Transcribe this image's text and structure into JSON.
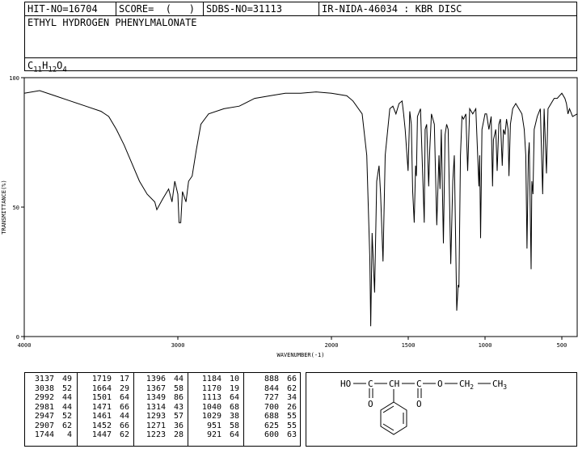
{
  "header": {
    "hit_no": "HIT-NO=16704",
    "score": "SCORE=  (   )",
    "sdbs_no": "SDBS-NO=31113",
    "ir_id": "IR-NIDA-46034 : KBR DISC",
    "compound_name": "ETHYL HYDROGEN PHENYLMALONATE",
    "formula": {
      "c": "C",
      "c_n": "11",
      "h": "H",
      "h_n": "12",
      "o": "O",
      "o_n": "4"
    }
  },
  "chart_data": {
    "type": "line",
    "xlabel": "WAVENUMBER(-1)",
    "ylabel": "TRANSMITTANCE(%)",
    "xlim": [
      4000,
      400
    ],
    "ylim": [
      0,
      100
    ],
    "x_ticks": [
      4000,
      3000,
      2000,
      1500,
      1000,
      500
    ],
    "y_ticks": [
      0,
      50,
      100
    ],
    "grid": false,
    "series": [
      {
        "points": [
          [
            4000,
            94
          ],
          [
            3900,
            95
          ],
          [
            3800,
            93
          ],
          [
            3700,
            91
          ],
          [
            3600,
            89
          ],
          [
            3500,
            87
          ],
          [
            3450,
            85
          ],
          [
            3400,
            80
          ],
          [
            3350,
            74
          ],
          [
            3300,
            67
          ],
          [
            3250,
            60
          ],
          [
            3200,
            55
          ],
          [
            3150,
            52
          ],
          [
            3137,
            49
          ],
          [
            3100,
            53
          ],
          [
            3060,
            57
          ],
          [
            3038,
            52
          ],
          [
            3020,
            60
          ],
          [
            3000,
            55
          ],
          [
            2992,
            44
          ],
          [
            2981,
            44
          ],
          [
            2970,
            56
          ],
          [
            2947,
            52
          ],
          [
            2930,
            60
          ],
          [
            2907,
            62
          ],
          [
            2880,
            72
          ],
          [
            2850,
            82
          ],
          [
            2800,
            86
          ],
          [
            2700,
            88
          ],
          [
            2600,
            89
          ],
          [
            2500,
            92
          ],
          [
            2400,
            93
          ],
          [
            2300,
            94
          ],
          [
            2200,
            94
          ],
          [
            2100,
            94.5
          ],
          [
            2000,
            94
          ],
          [
            1900,
            93
          ],
          [
            1860,
            91
          ],
          [
            1800,
            86
          ],
          [
            1770,
            70
          ],
          [
            1750,
            30
          ],
          [
            1744,
            4
          ],
          [
            1735,
            40
          ],
          [
            1719,
            17
          ],
          [
            1705,
            60
          ],
          [
            1690,
            66
          ],
          [
            1680,
            55
          ],
          [
            1664,
            29
          ],
          [
            1650,
            70
          ],
          [
            1620,
            88
          ],
          [
            1600,
            89
          ],
          [
            1580,
            86
          ],
          [
            1560,
            90
          ],
          [
            1540,
            91
          ],
          [
            1530,
            86
          ],
          [
            1520,
            80
          ],
          [
            1501,
            64
          ],
          [
            1490,
            87
          ],
          [
            1480,
            82
          ],
          [
            1471,
            56
          ],
          [
            1461,
            44
          ],
          [
            1452,
            66
          ],
          [
            1447,
            62
          ],
          [
            1440,
            85
          ],
          [
            1420,
            88
          ],
          [
            1396,
            44
          ],
          [
            1390,
            80
          ],
          [
            1380,
            82
          ],
          [
            1367,
            58
          ],
          [
            1360,
            72
          ],
          [
            1349,
            86
          ],
          [
            1330,
            82
          ],
          [
            1314,
            43
          ],
          [
            1300,
            70
          ],
          [
            1293,
            57
          ],
          [
            1285,
            80
          ],
          [
            1271,
            36
          ],
          [
            1260,
            78
          ],
          [
            1250,
            82
          ],
          [
            1240,
            80
          ],
          [
            1223,
            28
          ],
          [
            1210,
            60
          ],
          [
            1200,
            70
          ],
          [
            1184,
            10
          ],
          [
            1175,
            20
          ],
          [
            1170,
            19
          ],
          [
            1160,
            70
          ],
          [
            1150,
            85
          ],
          [
            1140,
            84
          ],
          [
            1125,
            86
          ],
          [
            1113,
            64
          ],
          [
            1100,
            88
          ],
          [
            1080,
            86
          ],
          [
            1060,
            88
          ],
          [
            1040,
            58
          ],
          [
            1035,
            70
          ],
          [
            1029,
            38
          ],
          [
            1020,
            80
          ],
          [
            1000,
            86
          ],
          [
            990,
            86
          ],
          [
            975,
            80
          ],
          [
            960,
            85
          ],
          [
            951,
            58
          ],
          [
            945,
            76
          ],
          [
            930,
            80
          ],
          [
            921,
            64
          ],
          [
            910,
            82
          ],
          [
            900,
            84
          ],
          [
            888,
            66
          ],
          [
            880,
            80
          ],
          [
            870,
            78
          ],
          [
            860,
            84
          ],
          [
            850,
            80
          ],
          [
            844,
            62
          ],
          [
            835,
            82
          ],
          [
            820,
            88
          ],
          [
            800,
            90
          ],
          [
            780,
            88
          ],
          [
            760,
            86
          ],
          [
            745,
            80
          ],
          [
            735,
            70
          ],
          [
            727,
            34
          ],
          [
            718,
            70
          ],
          [
            712,
            75
          ],
          [
            700,
            26
          ],
          [
            695,
            60
          ],
          [
            688,
            55
          ],
          [
            680,
            80
          ],
          [
            660,
            85
          ],
          [
            640,
            88
          ],
          [
            625,
            55
          ],
          [
            615,
            88
          ],
          [
            600,
            63
          ],
          [
            590,
            88
          ],
          [
            570,
            90
          ],
          [
            550,
            92
          ],
          [
            530,
            92
          ],
          [
            500,
            94
          ],
          [
            480,
            92
          ],
          [
            470,
            90
          ],
          [
            460,
            86
          ],
          [
            450,
            88
          ],
          [
            430,
            85
          ],
          [
            400,
            86
          ]
        ]
      }
    ]
  },
  "peak_table": {
    "columns": [
      [
        [
          "3137",
          "49"
        ],
        [
          "3038",
          "52"
        ],
        [
          "2992",
          "44"
        ],
        [
          "2981",
          "44"
        ],
        [
          "2947",
          "52"
        ],
        [
          "2907",
          "62"
        ],
        [
          "1744",
          "4"
        ]
      ],
      [
        [
          "1719",
          "17"
        ],
        [
          "1664",
          "29"
        ],
        [
          "1501",
          "64"
        ],
        [
          "1471",
          "66"
        ],
        [
          "1461",
          "44"
        ],
        [
          "1452",
          "66"
        ],
        [
          "1447",
          "62"
        ]
      ],
      [
        [
          "1396",
          "44"
        ],
        [
          "1367",
          "58"
        ],
        [
          "1349",
          "86"
        ],
        [
          "1314",
          "43"
        ],
        [
          "1293",
          "57"
        ],
        [
          "1271",
          "36"
        ],
        [
          "1223",
          "28"
        ]
      ],
      [
        [
          "1184",
          "10"
        ],
        [
          "1170",
          "19"
        ],
        [
          "1113",
          "64"
        ],
        [
          "1040",
          "68"
        ],
        [
          "1029",
          "38"
        ],
        [
          "951",
          "58"
        ],
        [
          "921",
          "64"
        ]
      ],
      [
        [
          "888",
          "66"
        ],
        [
          "844",
          "62"
        ],
        [
          "727",
          "34"
        ],
        [
          "700",
          "26"
        ],
        [
          "688",
          "55"
        ],
        [
          "625",
          "55"
        ],
        [
          "600",
          "63"
        ]
      ]
    ]
  },
  "structure": {
    "ho": "HO",
    "ch": "CH",
    "o": "O",
    "ch2_prefix": "CH",
    "ch2_sub": "2",
    "ch3": "CH",
    "ch3_sub": "3"
  }
}
